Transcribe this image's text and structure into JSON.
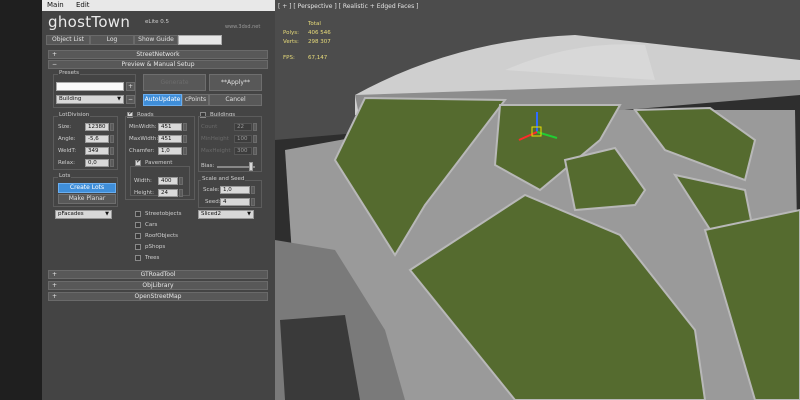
{
  "menu": {
    "items": [
      "Main",
      "Edit"
    ]
  },
  "logo": {
    "title": "ghostTown",
    "version": "eLite 0.5",
    "url": "www.3dsd.net"
  },
  "toolbar": {
    "object_list": "Object List",
    "log": "Log",
    "show_guide": "Show Guide"
  },
  "rollouts": {
    "street_network": "StreetNetwork",
    "preview_setup": "Preview & Manual Setup",
    "gt_road_tool": "GTRoadTool",
    "obj_library": "ObjLibrary",
    "open_street_map": "OpenStreetMap"
  },
  "presets": {
    "label": "Presets",
    "name_value": "",
    "plus": "+",
    "minus": "−",
    "type": "Building"
  },
  "actions": {
    "generate": "Generate",
    "apply": "**Apply**",
    "auto_update": "AutoUpdate",
    "cpoints": "cPoints",
    "cancel": "Cancel"
  },
  "lot_division": {
    "label": "LotDivision",
    "size_label": "Size:",
    "size": "12380",
    "angle_label": "Angle:",
    "angle": "-5,6",
    "weldt_label": "WeldT:",
    "weldt": "349",
    "relax_label": "Relax:",
    "relax": "0,0"
  },
  "roads": {
    "label": "Roads",
    "checked": true,
    "min_width_label": "MinWidth:",
    "min_width": "451",
    "max_width_label": "MaxWidth:",
    "max_width": "451",
    "chamfer_label": "Chamfer:",
    "chamfer": "1,0",
    "pavement_label": "Pavement",
    "pavement_checked": true,
    "width_label": "Width:",
    "width": "400",
    "height_label": "Height:",
    "height": "24"
  },
  "buildings": {
    "label": "Buildings",
    "checked": false,
    "rows": [
      {
        "label": "Count",
        "value": "22"
      },
      {
        "label": "MinHeight",
        "value": "100"
      },
      {
        "label": "MaxHeight",
        "value": "300"
      }
    ],
    "bias_label": "Bias:",
    "bias_level": 0.85
  },
  "scale_seed": {
    "label": "Scale and Seed",
    "scale_label": "Scale:",
    "scale": "1,0",
    "seed_label": "Seed:",
    "seed": "4"
  },
  "lots": {
    "label": "Lots",
    "create": "Create Lots",
    "make_planar": "Make Planar"
  },
  "facades_dropdown": "pFacades",
  "sliced_dropdown": "Sliced2",
  "checkboxes": [
    "Streetobjects",
    "Cars",
    "RoofObjects",
    "pShops",
    "Trees"
  ],
  "viewport": {
    "label": "[ + ] [ Perspective ] [ Realistic + Edged Faces ]",
    "stats_total": "Total",
    "polys_label": "Polys:",
    "polys": "406 546",
    "verts_label": "Verts:",
    "verts": "298 307",
    "fps_label": "FPS:",
    "fps": "67,147"
  }
}
